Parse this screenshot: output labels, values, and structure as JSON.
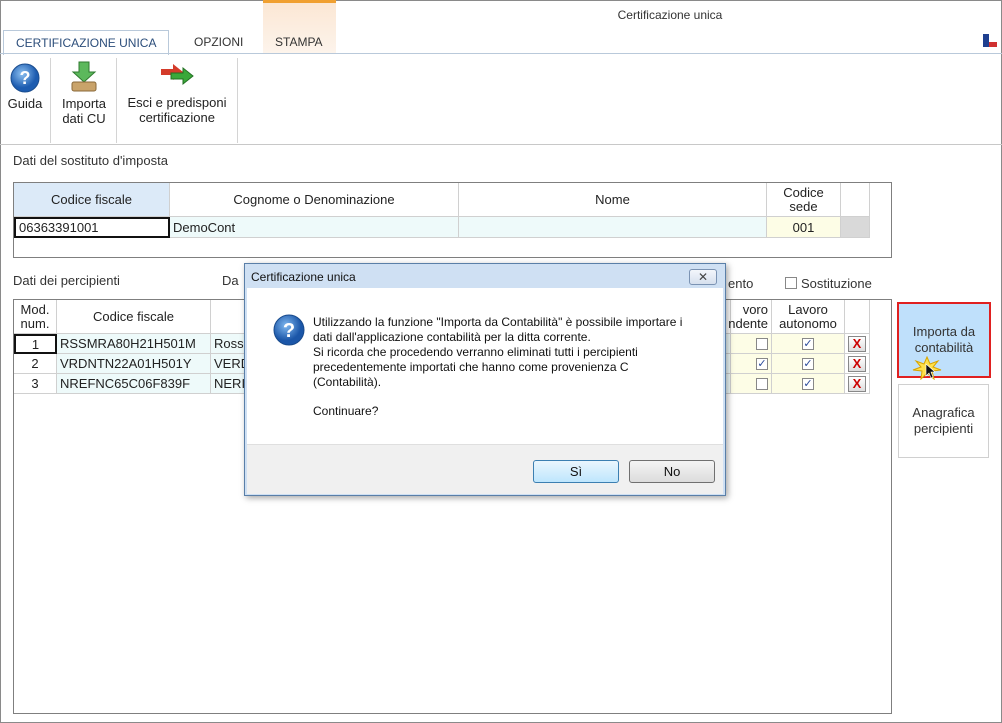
{
  "window": {
    "title": "Certificazione unica"
  },
  "tabs": [
    {
      "label": "CERTIFICAZIONE UNICA",
      "active": true
    },
    {
      "label": "OPZIONI"
    },
    {
      "label": "STAMPA"
    }
  ],
  "ribbon": {
    "guida": "Guida",
    "importa_line1": "Importa",
    "importa_line2": "dati CU",
    "esci_line1": "Esci e predisponi",
    "esci_line2": "certificazione"
  },
  "sostituto": {
    "section_label": "Dati del sostituto d'imposta",
    "headers": {
      "codice_fiscale": "Codice fiscale",
      "cognome": "Cognome o Denominazione",
      "nome": "Nome",
      "codice_sede_1": "Codice",
      "codice_sede_2": "sede"
    },
    "row": {
      "codice_fiscale": "06363391001",
      "cognome": "DemoCont",
      "nome": "",
      "codice_sede": "001"
    }
  },
  "percipienti": {
    "section_label": "Dati dei percipienti",
    "label_da": "Da",
    "label_ento": "ento",
    "sostituzione_label": "Sostituzione",
    "headers": {
      "mod_1": "Mod.",
      "mod_2": "num.",
      "codice_fiscale": "Codice fiscale",
      "dip_1": "voro",
      "dip_2": "ndente",
      "aut_1": "Lavoro",
      "aut_2": "autonomo"
    },
    "rows": [
      {
        "num": "1",
        "codice_fiscale": "RSSMRA80H21H501M",
        "cognome": "Ross",
        "dipendente": false,
        "autonomo": true
      },
      {
        "num": "2",
        "codice_fiscale": "VRDNTN22A01H501Y",
        "cognome": "VERD",
        "dipendente": true,
        "autonomo": true
      },
      {
        "num": "3",
        "codice_fiscale": "NREFNC65C06F839F",
        "cognome": "NERI",
        "dipendente": false,
        "autonomo": true
      }
    ],
    "delete_symbol": "X"
  },
  "side": {
    "importa_1": "Importa da",
    "importa_2": "contabilità",
    "anagrafica_1": "Anagrafica",
    "anagrafica_2": "percipienti"
  },
  "dialog": {
    "title": "Certificazione unica",
    "close": "✕",
    "line1": "Utilizzando la funzione \"Importa da Contabilità\" è possibile importare i",
    "line2": "dati dall'applicazione contabilità per la ditta corrente.",
    "line3": "Si ricorda che procedendo verranno eliminati tutti i percipienti",
    "line4": "precedentemente importati che hanno come provenienza C",
    "line5": "(Contabilità).",
    "line6": "Continuare?",
    "yes": "Sì",
    "no": "No"
  },
  "colors": {
    "accent": "#2b4d7a",
    "highlight_cell": "#eefafa",
    "sede_cell": "#fdfde6",
    "importa_bg": "#bfe0fb",
    "importa_border": "#e02020"
  }
}
